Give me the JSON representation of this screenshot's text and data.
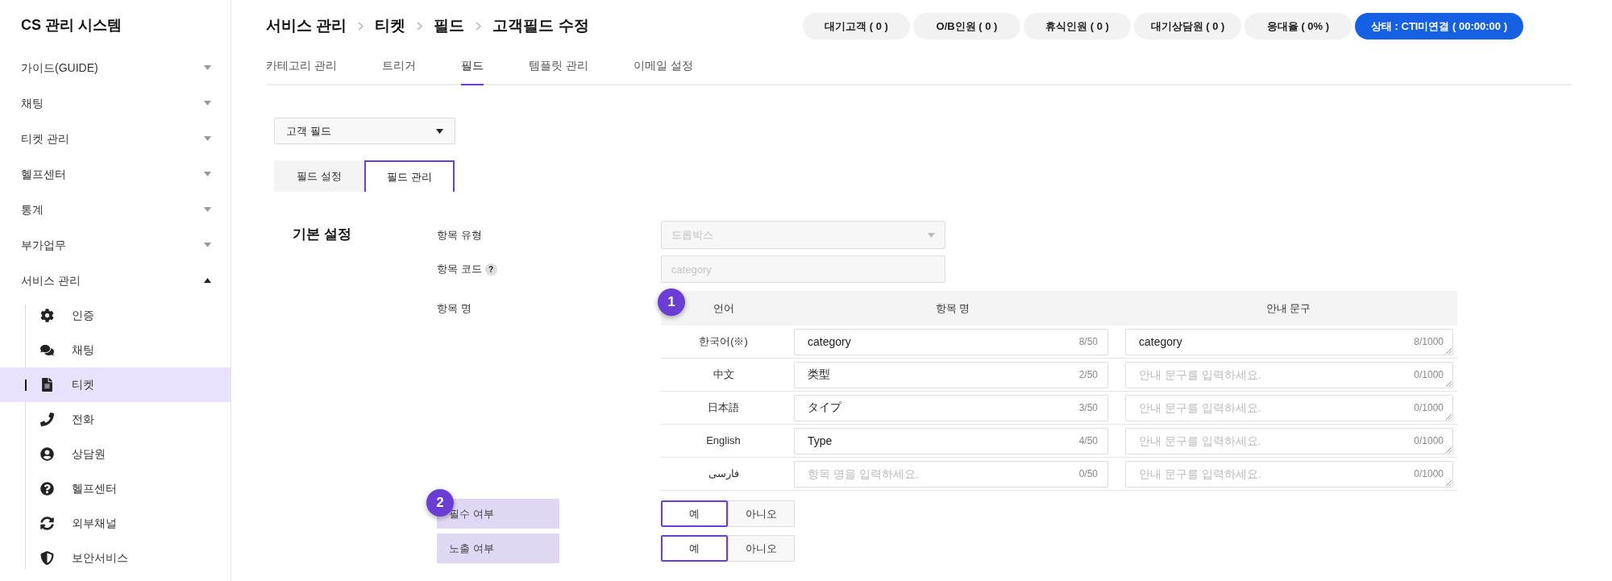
{
  "sidebar": {
    "title": "CS 관리 시스템",
    "menu": [
      {
        "label": "가이드(GUIDE)",
        "expanded": false
      },
      {
        "label": "채팅",
        "expanded": false
      },
      {
        "label": "티켓 관리",
        "expanded": false
      },
      {
        "label": "헬프센터",
        "expanded": false
      },
      {
        "label": "통계",
        "expanded": false
      },
      {
        "label": "부가업무",
        "expanded": false
      },
      {
        "label": "서비스 관리",
        "expanded": true,
        "children": [
          {
            "label": "인증",
            "selected": false
          },
          {
            "label": "채팅",
            "selected": false
          },
          {
            "label": "티켓",
            "selected": true
          },
          {
            "label": "전화",
            "selected": false
          },
          {
            "label": "상담원",
            "selected": false
          },
          {
            "label": "헬프센터",
            "selected": false
          },
          {
            "label": "외부채널",
            "selected": false
          },
          {
            "label": "보안서비스",
            "selected": false
          }
        ]
      }
    ]
  },
  "header": {
    "breadcrumb": [
      "서비스 관리",
      "티켓",
      "필드",
      "고객필드 수정"
    ],
    "status": [
      {
        "label": "대기고객 ( 0 )",
        "kind": "count"
      },
      {
        "label": "O/B인원 ( 0 )",
        "kind": "count"
      },
      {
        "label": "휴식인원 ( 0 )",
        "kind": "count"
      },
      {
        "label": "대기상담원 ( 0 )",
        "kind": "count"
      },
      {
        "label": "응대율 ( 0% )",
        "kind": "count"
      },
      {
        "label": "상태 : CTI미연결 ( 00:00:00 )",
        "kind": "status"
      }
    ],
    "tabs": [
      {
        "label": "카테고리 관리",
        "selected": false
      },
      {
        "label": "트리거",
        "selected": false
      },
      {
        "label": "필드",
        "selected": true
      },
      {
        "label": "템플릿 관리",
        "selected": false
      },
      {
        "label": "이메일 설정",
        "selected": false
      }
    ]
  },
  "field_type_select": {
    "value": "고객 필드"
  },
  "subtabs": [
    {
      "label": "필드 설정",
      "selected": false
    },
    {
      "label": "필드 관리",
      "selected": true
    }
  ],
  "section": {
    "title": "기본 설정",
    "item_type": {
      "label": "항목 유형",
      "value": "드롭박스",
      "disabled": true
    },
    "item_code": {
      "label": "항목 코드",
      "help": "?",
      "placeholder": "category",
      "disabled": true
    },
    "item_name": {
      "label": "항목 명",
      "badge": "1",
      "columns": [
        "언어",
        "항목 명",
        "안내 문구"
      ],
      "rows": [
        {
          "language": "한국어(※)",
          "name": {
            "value": "category",
            "counter": "8/50"
          },
          "guide": {
            "value": "category",
            "counter": "8/1000"
          }
        },
        {
          "language": "中文",
          "name": {
            "value": "类型",
            "counter": "2/50"
          },
          "guide": {
            "placeholder": "안내 문구를 입력하세요.",
            "counter": "0/1000"
          }
        },
        {
          "language": "日本語",
          "name": {
            "value": "タイプ",
            "counter": "3/50"
          },
          "guide": {
            "placeholder": "안내 문구를 입력하세요.",
            "counter": "0/1000"
          }
        },
        {
          "language": "English",
          "name": {
            "value": "Type",
            "counter": "4/50"
          },
          "guide": {
            "placeholder": "안내 문구를 입력하세요.",
            "counter": "0/1000"
          }
        },
        {
          "language": "فارسی",
          "name": {
            "placeholder": "항목 명을 입력하세요.",
            "counter": "0/50"
          },
          "guide": {
            "placeholder": "안내 문구를 입력하세요.",
            "counter": "0/1000"
          }
        }
      ]
    },
    "toggles_badge": "2",
    "toggles": [
      {
        "label": "필수 여부",
        "options": [
          {
            "label": "예",
            "selected": true
          },
          {
            "label": "아니오",
            "selected": false
          }
        ]
      },
      {
        "label": "노출 여부",
        "options": [
          {
            "label": "예",
            "selected": true
          },
          {
            "label": "아니오",
            "selected": false
          }
        ]
      }
    ]
  }
}
